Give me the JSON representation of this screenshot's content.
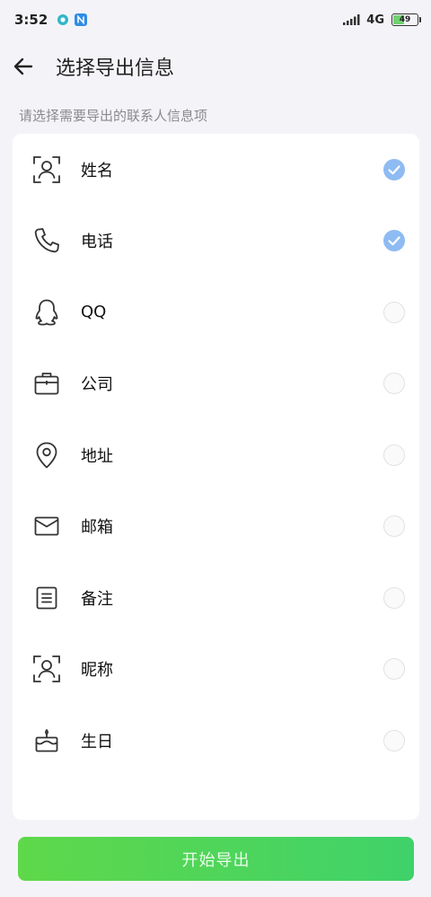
{
  "status_bar": {
    "time": "3:52",
    "network": "4G",
    "battery": "49",
    "battery_level": 0.49
  },
  "header": {
    "title": "选择导出信息"
  },
  "subtitle": "请选择需要导出的联系人信息项",
  "items": [
    {
      "label": "姓名",
      "icon": "person-frame-icon",
      "checked": true
    },
    {
      "label": "电话",
      "icon": "phone-icon",
      "checked": true
    },
    {
      "label": "QQ",
      "icon": "qq-penguin-icon",
      "checked": false
    },
    {
      "label": "公司",
      "icon": "briefcase-icon",
      "checked": false
    },
    {
      "label": "地址",
      "icon": "location-pin-icon",
      "checked": false
    },
    {
      "label": "邮箱",
      "icon": "envelope-icon",
      "checked": false
    },
    {
      "label": "备注",
      "icon": "note-icon",
      "checked": false
    },
    {
      "label": "昵称",
      "icon": "person-frame-icon",
      "checked": false
    },
    {
      "label": "生日",
      "icon": "birthday-cake-icon",
      "checked": false
    }
  ],
  "export_button": {
    "label": "开始导出"
  },
  "colors": {
    "checked": "#8ebbf2",
    "button_start": "#5fd84a",
    "button_end": "#3fd26a"
  }
}
